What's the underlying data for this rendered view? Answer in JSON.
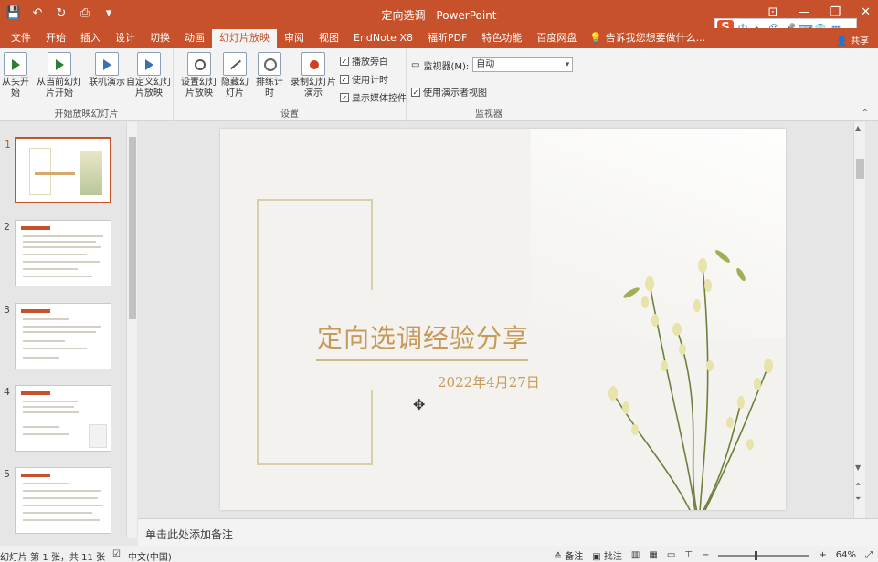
{
  "window": {
    "title": "定向选调 - PowerPoint"
  },
  "quick_access": {
    "icons": [
      "save-icon",
      "undo-icon",
      "redo-icon",
      "start-icon",
      "customize-icon"
    ],
    "glyphs": [
      "💾",
      "↶",
      "↻",
      "⎙",
      "▾"
    ]
  },
  "tabs": [
    {
      "label": "文件"
    },
    {
      "label": "开始"
    },
    {
      "label": "插入"
    },
    {
      "label": "设计"
    },
    {
      "label": "切换"
    },
    {
      "label": "动画"
    },
    {
      "label": "幻灯片放映",
      "active": true
    },
    {
      "label": "审阅"
    },
    {
      "label": "视图"
    },
    {
      "label": "EndNote X8"
    },
    {
      "label": "福昕PDF"
    },
    {
      "label": "特色功能"
    },
    {
      "label": "百度网盘"
    }
  ],
  "tell_me": "告诉我您想要做什么...",
  "share": "共享",
  "ime": {
    "chars": [
      "中",
      "•,",
      "☺",
      "🎤",
      "⌨",
      "👕",
      "▦"
    ]
  },
  "ribbon": {
    "group_start": {
      "label": "开始放映幻灯片",
      "buttons": {
        "from_beginning": "从头开始",
        "from_current": "从当前幻灯片开始",
        "online": "联机演示",
        "custom": "自定义幻灯片放映"
      }
    },
    "group_setup": {
      "label": "设置",
      "buttons": {
        "setup_show": "设置幻灯片放映",
        "hide_slide": "隐藏幻灯片",
        "rehearse": "排练计时",
        "record": "录制幻灯片演示"
      },
      "checks": [
        {
          "label": "播放旁白",
          "checked": true
        },
        {
          "label": "使用计时",
          "checked": true
        },
        {
          "label": "显示媒体控件",
          "checked": true
        }
      ]
    },
    "group_monitor": {
      "label": "监视器",
      "monitor_label": "监视器(M):",
      "monitor_value": "自动",
      "presenter_view": "使用演示者视图",
      "presenter_checked": true
    }
  },
  "thumbnails": [
    {
      "num": "1"
    },
    {
      "num": "2"
    },
    {
      "num": "3"
    },
    {
      "num": "4"
    },
    {
      "num": "5"
    }
  ],
  "slide": {
    "title": "定向选调经验分享",
    "date": "2022年4月27日"
  },
  "notes_placeholder": "单击此处添加备注",
  "status": {
    "slide_info": "幻灯片 第 1 张，共 11 张",
    "language": "中文(中国)",
    "notes": "备注",
    "comments": "批注",
    "zoom": "64%"
  }
}
